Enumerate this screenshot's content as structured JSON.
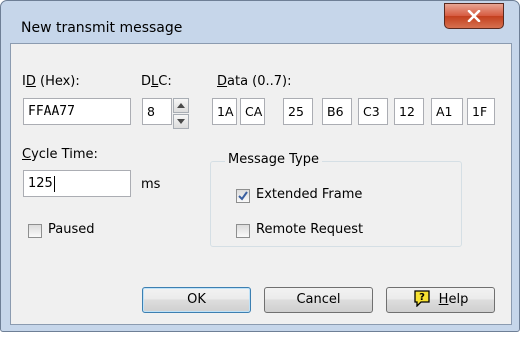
{
  "window": {
    "title": "New transmit message"
  },
  "labels": {
    "id_pre": "I",
    "id_u": "D",
    "id_post": " (Hex):",
    "dlc_pre": "D",
    "dlc_u": "L",
    "dlc_post": "C:",
    "data_u": "D",
    "data_post": "ata (0..7):",
    "cycle_u": "C",
    "cycle_post": "ycle Time:",
    "ms": "ms"
  },
  "fields": {
    "id_value": "FFAA77",
    "dlc_value": "8",
    "data": [
      "1A",
      "CA",
      "25",
      "B6",
      "C3",
      "12",
      "A1",
      "1F"
    ],
    "cycle_time": "125"
  },
  "paused": {
    "label": "Paused",
    "checked": false
  },
  "message_type": {
    "title": "Message Type",
    "extended_frame": {
      "label": "Extended Frame",
      "checked": true
    },
    "remote_request": {
      "label": "Remote Request",
      "checked": false
    }
  },
  "buttons": {
    "ok": "OK",
    "cancel": "Cancel",
    "help_u": "H",
    "help_post": "elp"
  },
  "colors": {
    "frame": "#c6d6ea",
    "client": "#f0f0f0",
    "close": "#c3401f",
    "check": "#3a5fa0"
  }
}
